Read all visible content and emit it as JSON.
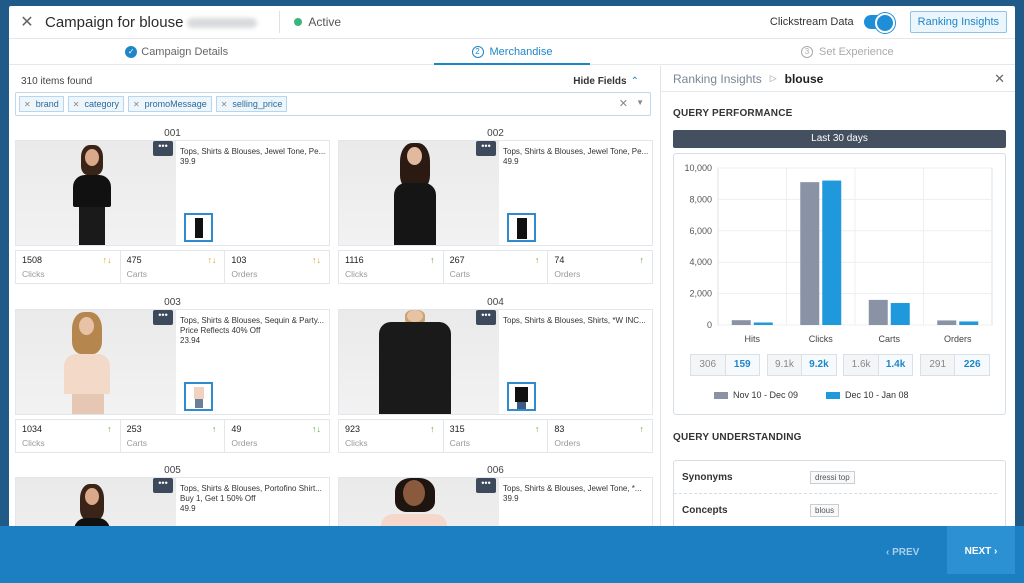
{
  "header": {
    "title": "Campaign for blouse",
    "status": "Active",
    "clickstream_label": "Clickstream Data",
    "ranking_insights_button": "Ranking Insights",
    "close_glyph": "✕"
  },
  "steps": [
    {
      "num": "✓",
      "label": "Campaign Details"
    },
    {
      "num": "2",
      "label": "Merchandise"
    },
    {
      "num": "3",
      "label": "Set Experience"
    }
  ],
  "results": {
    "items_found": "310 items found",
    "hide_fields": "Hide Fields",
    "fields": [
      "brand",
      "category",
      "promoMessage",
      "selling_price"
    ]
  },
  "products": [
    {
      "num": "001",
      "lines": [
        "Tops, Shirts & Blouses, Jewel Tone, Pe...",
        "39.9"
      ],
      "clicks": "1508",
      "carts": "475",
      "orders": "103",
      "arrows": [
        "↑↓",
        "↑↓",
        "↑↓"
      ]
    },
    {
      "num": "002",
      "lines": [
        "Tops, Shirts & Blouses, Jewel Tone, Pe...",
        "49.9"
      ],
      "clicks": "1116",
      "carts": "267",
      "orders": "74",
      "arrows": [
        "↑",
        "↑",
        "↑"
      ]
    },
    {
      "num": "003",
      "lines": [
        "Tops, Shirts & Blouses, Sequin & Party...",
        "Price Reflects 40% Off",
        "23.94"
      ],
      "clicks": "1034",
      "carts": "253",
      "orders": "49",
      "arrows": [
        "↑",
        "↑",
        "↑↓"
      ]
    },
    {
      "num": "004",
      "lines": [
        "Tops, Shirts & Blouses, Shirts, *W INC..."
      ],
      "clicks": "923",
      "carts": "315",
      "orders": "83",
      "arrows": [
        "↑",
        "↑",
        "↑"
      ]
    },
    {
      "num": "005",
      "lines": [
        "Tops, Shirts & Blouses, Portofino Shirt...",
        "Buy 1, Get 1 50% Off",
        "49.9"
      ]
    },
    {
      "num": "006",
      "lines": [
        "Tops, Shirts & Blouses, Jewel Tone, *...",
        "39.9"
      ]
    }
  ],
  "stat_labels": {
    "clicks": "Clicks",
    "carts": "Carts",
    "orders": "Orders"
  },
  "insights": {
    "label": "Ranking Insights",
    "query": "blouse",
    "query_performance": "QUERY PERFORMANCE",
    "period": "Last 30 days",
    "pairs": [
      {
        "old": "306",
        "new": "159"
      },
      {
        "old": "9.1k",
        "new": "9.2k"
      },
      {
        "old": "1.6k",
        "new": "1.4k"
      },
      {
        "old": "291",
        "new": "226"
      }
    ],
    "query_understanding": "QUERY UNDERSTANDING",
    "synonyms_label": "Synonyms",
    "synonyms_value": "dressi top",
    "concepts_label": "Concepts",
    "concepts_value": "blous"
  },
  "chart_data": {
    "type": "bar",
    "categories": [
      "Hits",
      "Clicks",
      "Carts",
      "Orders"
    ],
    "series": [
      {
        "name": "Nov 10 - Dec 09",
        "values": [
          306,
          9100,
          1600,
          291
        ],
        "color": "#8a93a6"
      },
      {
        "name": "Dec 10 - Jan 08",
        "values": [
          159,
          9200,
          1400,
          226
        ],
        "color": "#1f98dc"
      }
    ],
    "ylim": [
      0,
      10000
    ],
    "yticks": [
      0,
      2000,
      4000,
      6000,
      8000,
      10000
    ],
    "ytick_labels": [
      "0",
      "2,000",
      "4,000",
      "6,000",
      "8,000",
      "10,000"
    ],
    "grid": true,
    "legend": "bottom"
  },
  "footer": {
    "prev": "‹ PREV",
    "next": "NEXT ›"
  }
}
